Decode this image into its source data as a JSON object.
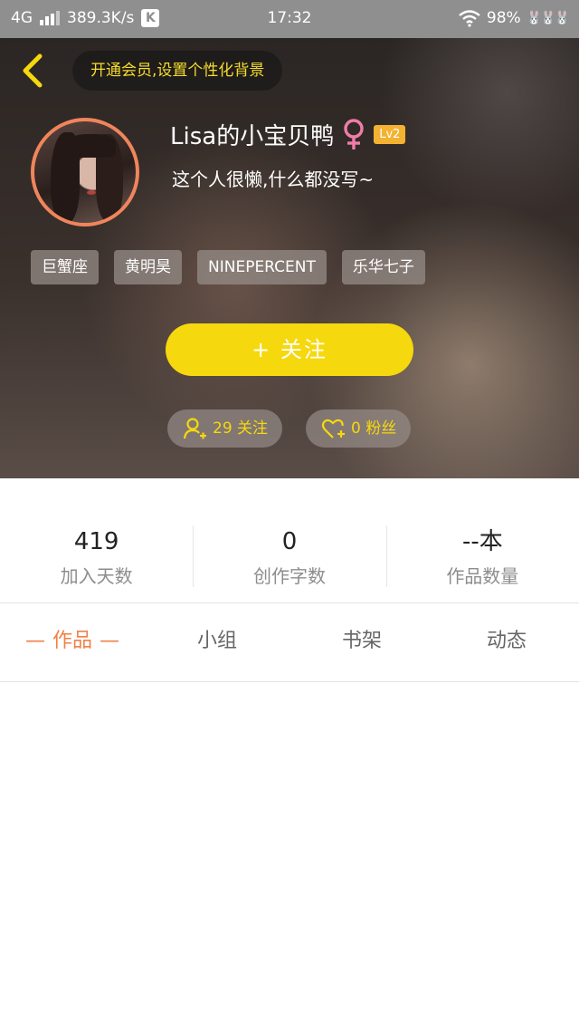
{
  "status_bar": {
    "network": "4G",
    "speed": "389.3K/s",
    "k_label": "K",
    "time": "17:32",
    "battery": "98%"
  },
  "header": {
    "vip_prompt": "开通会员,设置个性化背景",
    "username": "Lisa的小宝贝鸭",
    "level": "Lv2",
    "bio": "这个人很懒,什么都没写~",
    "tags": [
      "巨蟹座",
      "黄明昊",
      "NINEPERCENT",
      "乐华七子"
    ],
    "follow_label": "+  关注",
    "following_text": "29 关注",
    "fans_text": "0 粉丝",
    "colors": {
      "accent_yellow": "#f6d80e",
      "avatar_ring": "#f0855c",
      "female_pink": "#f07ca8"
    }
  },
  "stats": [
    {
      "value": "419",
      "label": "加入天数"
    },
    {
      "value": "0",
      "label": "创作字数"
    },
    {
      "value": "--本",
      "label": "作品数量"
    }
  ],
  "tabs": [
    {
      "label": "作品",
      "active": true
    },
    {
      "label": "小组",
      "active": false
    },
    {
      "label": "书架",
      "active": false
    },
    {
      "label": "动态",
      "active": false
    }
  ],
  "icons": [
    "back-chevron-icon",
    "female-icon",
    "follow-person-icon",
    "heart-plus-icon",
    "wifi-icon",
    "signal-icon"
  ]
}
